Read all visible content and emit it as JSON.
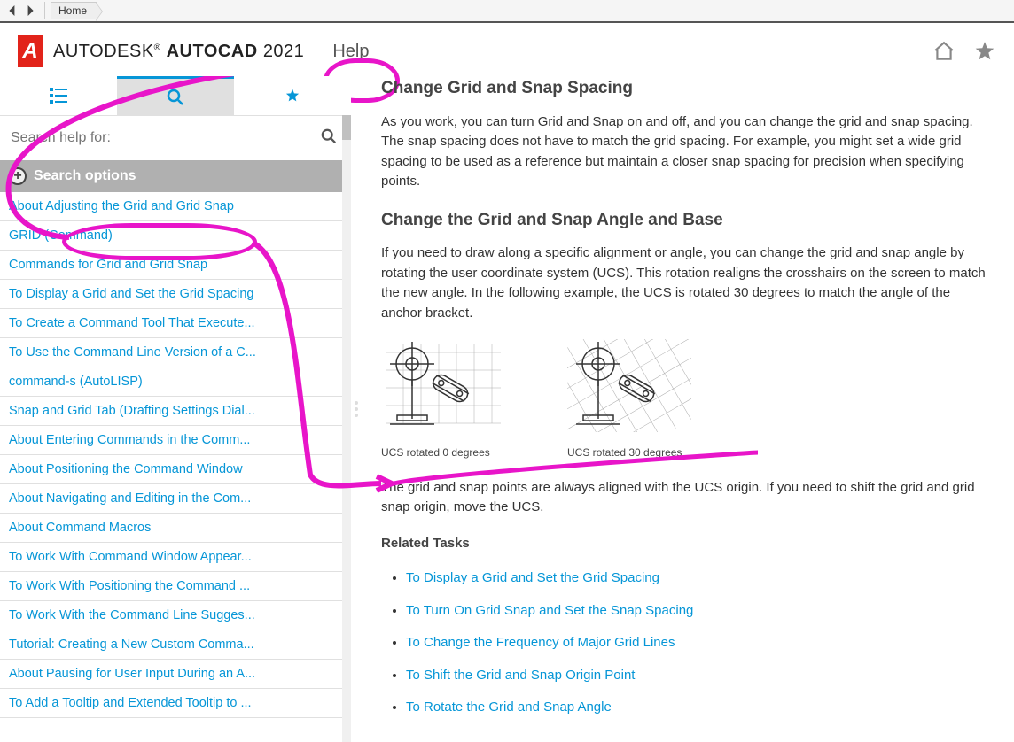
{
  "browser": {
    "home": "Home"
  },
  "header": {
    "brand_prefix": "AUTODESK",
    "brand_reg": "®",
    "brand_product": "AUTOCAD",
    "brand_year": "2021",
    "help_tab": "Help"
  },
  "sidebar": {
    "search_placeholder": "Search help for:",
    "search_options": "Search options",
    "results": [
      "About Adjusting the Grid and Grid Snap",
      "GRID (Command)",
      "Commands for Grid and Grid Snap",
      "To Display a Grid and Set the Grid Spacing",
      "To Create a Command Tool That Execute...",
      "To Use the Command Line Version of a C...",
      "command-s (AutoLISP)",
      "Snap and Grid Tab (Drafting Settings Dial...",
      "About Entering Commands in the Comm...",
      "About Positioning the Command Window",
      "About Navigating and Editing in the Com...",
      "About Command Macros",
      "To Work With Command Window Appear...",
      "To Work With Positioning the Command ...",
      "To Work With the Command Line Sugges...",
      "Tutorial: Creating a New Custom Comma...",
      "About Pausing for User Input During an A...",
      "To Add a Tooltip and Extended Tooltip to ..."
    ]
  },
  "content": {
    "h1": "Change Grid and Snap Spacing",
    "p1": "As you work, you can turn Grid and Snap on and off, and you can change the grid and snap spacing. The snap spacing does not have to match the grid spacing. For example, you might set a wide grid spacing to be used as a reference but maintain a closer snap spacing for precision when specifying points.",
    "h2": "Change the Grid and Snap Angle and Base",
    "p2": "If you need to draw along a specific alignment or angle, you can change the grid and snap angle by rotating the user coordinate system (UCS). This rotation realigns the crosshairs on the screen to match the new angle. In the following example, the UCS is rotated 30 degrees to match the angle of the anchor bracket.",
    "fig1_caption": "UCS rotated 0 degrees",
    "fig2_caption": "UCS rotated 30 degrees",
    "p3": "The grid and snap points are always aligned with the UCS origin. If you need to shift the grid and grid snap origin, move the UCS.",
    "related_heading": "Related Tasks",
    "related": [
      "To Display a Grid and Set the Grid Spacing",
      "To Turn On Grid Snap and Set the Snap Spacing",
      "To Change the Frequency of Major Grid Lines",
      "To Shift the Grid and Snap Origin Point",
      "To Rotate the Grid and Snap Angle"
    ]
  }
}
